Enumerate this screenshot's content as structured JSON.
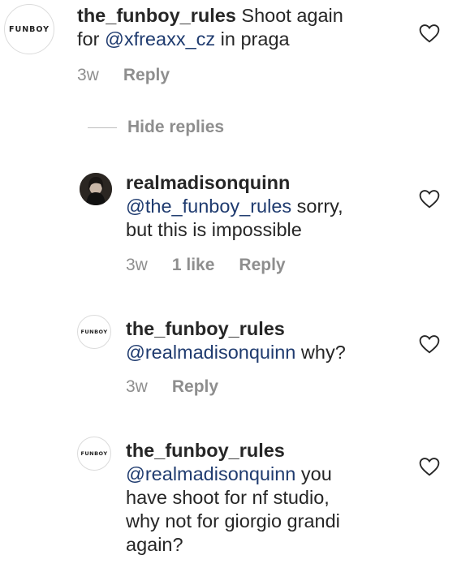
{
  "comments": [
    {
      "avatar_logo": "FUNBOY",
      "username": "the_funboy_rules",
      "text_before": "Shoot again",
      "text_line2_prefix": "for ",
      "mention": "@xfreaxx_cz",
      "text_after": " in praga",
      "time": "3w",
      "reply_label": "Reply"
    },
    {
      "username": "realmadisonquinn",
      "mention": "@the_funboy_rules",
      "text_after": " sorry,",
      "text_line3": "but this is impossible",
      "time": "3w",
      "likes": "1 like",
      "reply_label": "Reply"
    },
    {
      "avatar_logo": "FUNBOY",
      "username": "the_funboy_rules",
      "mention": "@realmadisonquinn",
      "text_after": " why?",
      "time": "3w",
      "reply_label": "Reply"
    },
    {
      "avatar_logo": "FUNBOY",
      "username": "the_funboy_rules",
      "mention": "@realmadisonquinn",
      "text_after": " you",
      "text_line3": "have shoot for nf studio,",
      "text_line4": "why not for giorgio grandi",
      "text_line5": "again?"
    }
  ],
  "hide_replies_label": "Hide replies",
  "icons": {
    "like": "heart-outline-icon"
  },
  "colors": {
    "mention": "#1f3b6f",
    "meta": "#8e8e8e",
    "text": "#262626"
  }
}
